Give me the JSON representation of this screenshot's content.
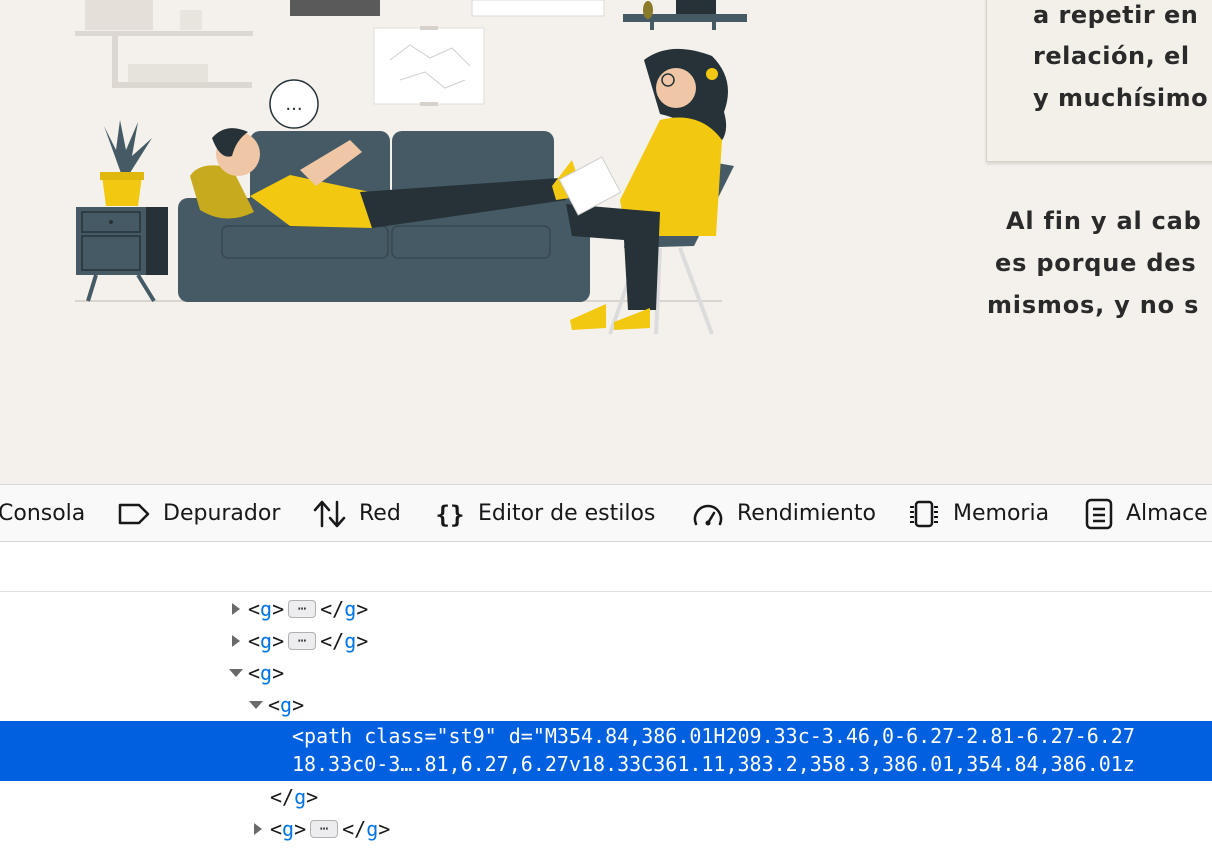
{
  "page": {
    "quote_lines": [
      "a repetir en",
      "relación, el",
      "y muchísimo"
    ],
    "paragraph_lines": [
      "Al fin y al cab",
      "es porque des",
      "mismos, y no s"
    ],
    "speech_bubble": "..."
  },
  "devtools": {
    "tabs": [
      {
        "label": "Consola",
        "icon": "console-icon"
      },
      {
        "label": "Depurador",
        "icon": "debugger-icon"
      },
      {
        "label": "Red",
        "icon": "network-icon"
      },
      {
        "label": "Editor de estilos",
        "icon": "style-editor-icon"
      },
      {
        "label": "Rendimiento",
        "icon": "performance-icon"
      },
      {
        "label": "Memoria",
        "icon": "memory-icon"
      },
      {
        "label": "Almace",
        "icon": "storage-icon"
      }
    ],
    "markup": {
      "tag_name": "g",
      "collapsed_badge": "⋯",
      "selected_line_1": "<path class=\"st9\" d=\"M354.84,386.01H209.33c-3.46,0-6.27-2.81-6.27-6.27",
      "selected_line_2": "18.33c0-3….81,6.27,6.27v18.33C361.11,383.2,358.3,386.01,354.84,386.01z"
    }
  },
  "colors": {
    "page_background": "#f4f1ec",
    "sofa": "#455a64",
    "accent_yellow": "#f2c811",
    "selection_blue": "#0060df",
    "tag_blue": "#0074e8"
  }
}
